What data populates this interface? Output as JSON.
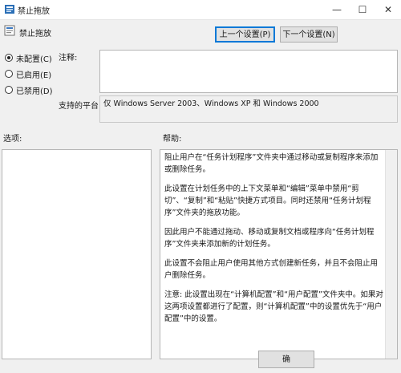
{
  "window": {
    "title": "禁止拖放",
    "close_glyph": "✕",
    "minimize_glyph": "—",
    "maximize_glyph": "☐"
  },
  "header": {
    "policy_name": "禁止拖放"
  },
  "nav": {
    "prev_label": "上一个设置(P)",
    "next_label": "下一个设置(N)"
  },
  "options": [
    {
      "label": "未配置(C)",
      "selected": true
    },
    {
      "label": "已启用(E)",
      "selected": false
    },
    {
      "label": "已禁用(D)",
      "selected": false
    }
  ],
  "comment": {
    "label": "注释:",
    "value": ""
  },
  "platform": {
    "label": "支持的平台:",
    "value": "仅 Windows Server 2003、Windows XP 和 Windows 2000"
  },
  "sections": {
    "options_label": "选项:",
    "help_label": "帮助:"
  },
  "help": [
    "阻止用户在“任务计划程序”文件夹中通过移动或复制程序来添加或删除任务。",
    "此设置在计划任务中的上下文菜单和“编辑”菜单中禁用“剪切”、“复制”和“粘贴”快捷方式项目。同时还禁用“任务计划程序”文件夹的拖放功能。",
    "因此用户不能通过拖动、移动或复制文档或程序向“任务计划程序”文件夹来添加新的计划任务。",
    "此设置不会阻止用户使用其他方式创建新任务，并且不会阻止用户删除任务。",
    "注意: 此设置出现在“计算机配置”和“用户配置”文件夹中。如果对这两项设置都进行了配置，则“计算机配置”中的设置优先于“用户配置”中的设置。"
  ],
  "footer": {
    "ok_label": "确"
  }
}
